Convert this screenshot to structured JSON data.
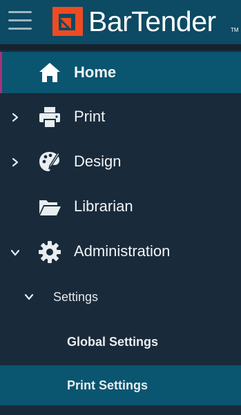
{
  "header": {
    "app_name": "BarTender",
    "trademark": "TM",
    "menu_icon": "hamburger-menu-icon",
    "logo_icon": "bartender-logo-mark",
    "colors": {
      "header_bg": "#0d4a63",
      "sidebar_bg": "#192a3a",
      "active_bg": "#0a5570",
      "logo_orange": "#ef4b23",
      "active_accent": "#a8327a"
    }
  },
  "nav": {
    "home": {
      "label": "Home",
      "icon": "home-icon",
      "active": true
    },
    "print": {
      "label": "Print",
      "icon": "printer-icon",
      "expanded": false
    },
    "design": {
      "label": "Design",
      "icon": "palette-icon",
      "expanded": false
    },
    "librarian": {
      "label": "Librarian",
      "icon": "folder-open-icon"
    },
    "administration": {
      "label": "Administration",
      "icon": "gear-icon",
      "expanded": true
    },
    "settings": {
      "label": "Settings",
      "expanded": true
    },
    "global_settings": {
      "label": "Global Settings"
    },
    "print_settings": {
      "label": "Print Settings",
      "selected": true
    }
  }
}
